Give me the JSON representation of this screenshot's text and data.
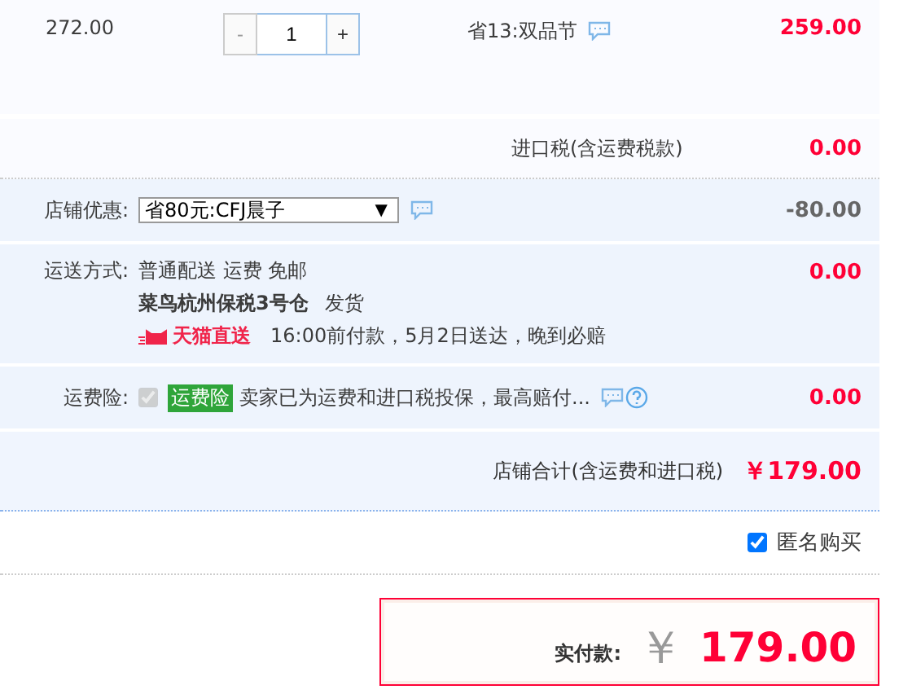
{
  "item": {
    "unit_price": "272.00",
    "quantity": {
      "minus": "-",
      "value": "1",
      "plus": "+"
    },
    "promotion": "省13:双品节",
    "amount": "259.00"
  },
  "import_tax": {
    "label": "进口税(含运费税款)",
    "amount": "0.00"
  },
  "shop_discount": {
    "label": "店铺优惠:",
    "selected_option": "省80元:CFJ晨子",
    "arrow": "▼",
    "amount": "-80.00"
  },
  "shipping": {
    "label": "运送方式:",
    "method": "普通配送 运费 免邮",
    "warehouse": "菜鸟杭州保税3号仓",
    "ship_text": "发货",
    "badge": "天猫直送",
    "delivery_note": "16:00前付款，5月2日送达，晚到必赔",
    "amount": "0.00"
  },
  "insurance": {
    "label": "运费险:",
    "checked": true,
    "disabled": true,
    "tag": "运费险",
    "text": "卖家已为运费和进口税投保，最高赔付...",
    "amount": "0.00"
  },
  "shop_total": {
    "label": "店铺合计(含运费和进口税)",
    "amount": "￥179.00"
  },
  "anonymous": {
    "label": "匿名购买",
    "checked": true
  },
  "payment": {
    "label": "实付款:",
    "currency": "￥",
    "amount": "179.00"
  }
}
